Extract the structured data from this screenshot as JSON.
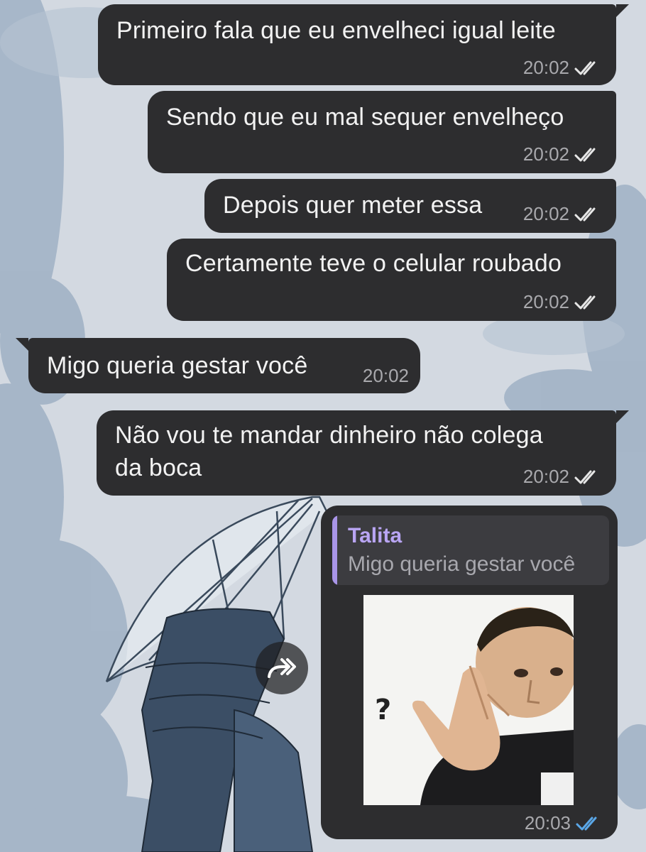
{
  "chat": {
    "messages": [
      {
        "text": "Primeiro fala que eu envelheci igual leite",
        "time": "20:02",
        "direction": "outgoing",
        "status": "read"
      },
      {
        "text": "Sendo que eu mal sequer envelheço",
        "time": "20:02",
        "direction": "outgoing",
        "status": "read"
      },
      {
        "text": "Depois quer meter essa",
        "time": "20:02",
        "direction": "outgoing",
        "status": "read"
      },
      {
        "text": "Certamente teve o celular roubado",
        "time": "20:02",
        "direction": "outgoing",
        "status": "read"
      },
      {
        "text": "Migo queria gestar você",
        "time": "20:02",
        "direction": "incoming"
      },
      {
        "text_line1": "Não vou te mandar dinheiro não colega",
        "text_line2": "da boca",
        "time": "20:02",
        "direction": "outgoing",
        "status": "read"
      }
    ],
    "reply_message": {
      "quoted_name": "Talita",
      "quoted_text": "Migo queria gestar você",
      "sticker_caption": "?",
      "time": "20:03",
      "direction": "outgoing",
      "status": "read-blue"
    }
  },
  "icons": {
    "read_ticks": "double-check-icon",
    "forward": "forward-arrow-icon"
  },
  "colors": {
    "bubble": "#2d2d2f",
    "time_text": "#a9a9ad",
    "ticks_gray": "#e6e6e6",
    "ticks_blue": "#5aa7e8",
    "reply_accent": "#a995e8",
    "reply_name": "#b9a5f3"
  }
}
